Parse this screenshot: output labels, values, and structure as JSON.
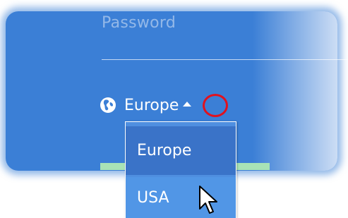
{
  "login": {
    "password_placeholder": "Password"
  },
  "region": {
    "selected": "Europe",
    "icon": "globe-icon",
    "toggle_icon": "up-arrow-icon"
  },
  "dropdown": {
    "options": [
      {
        "label": "Europe"
      },
      {
        "label": "USA"
      }
    ]
  },
  "colors": {
    "panel": "#3b7fd6",
    "dropdown_bg": "#4f8fe0",
    "selected_option": "#3a73c8",
    "highlight_ring": "#e0121f",
    "accent_bar": "#a8e3b6"
  }
}
